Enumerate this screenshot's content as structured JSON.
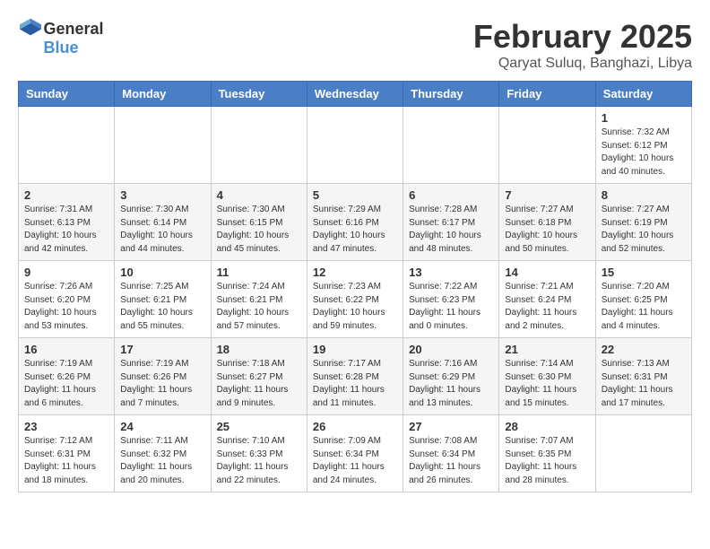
{
  "logo": {
    "general": "General",
    "blue": "Blue"
  },
  "title": {
    "month": "February 2025",
    "location": "Qaryat Suluq, Banghazi, Libya"
  },
  "headers": [
    "Sunday",
    "Monday",
    "Tuesday",
    "Wednesday",
    "Thursday",
    "Friday",
    "Saturday"
  ],
  "weeks": [
    [
      {
        "day": "",
        "info": ""
      },
      {
        "day": "",
        "info": ""
      },
      {
        "day": "",
        "info": ""
      },
      {
        "day": "",
        "info": ""
      },
      {
        "day": "",
        "info": ""
      },
      {
        "day": "",
        "info": ""
      },
      {
        "day": "1",
        "info": "Sunrise: 7:32 AM\nSunset: 6:12 PM\nDaylight: 10 hours\nand 40 minutes."
      }
    ],
    [
      {
        "day": "2",
        "info": "Sunrise: 7:31 AM\nSunset: 6:13 PM\nDaylight: 10 hours\nand 42 minutes."
      },
      {
        "day": "3",
        "info": "Sunrise: 7:30 AM\nSunset: 6:14 PM\nDaylight: 10 hours\nand 44 minutes."
      },
      {
        "day": "4",
        "info": "Sunrise: 7:30 AM\nSunset: 6:15 PM\nDaylight: 10 hours\nand 45 minutes."
      },
      {
        "day": "5",
        "info": "Sunrise: 7:29 AM\nSunset: 6:16 PM\nDaylight: 10 hours\nand 47 minutes."
      },
      {
        "day": "6",
        "info": "Sunrise: 7:28 AM\nSunset: 6:17 PM\nDaylight: 10 hours\nand 48 minutes."
      },
      {
        "day": "7",
        "info": "Sunrise: 7:27 AM\nSunset: 6:18 PM\nDaylight: 10 hours\nand 50 minutes."
      },
      {
        "day": "8",
        "info": "Sunrise: 7:27 AM\nSunset: 6:19 PM\nDaylight: 10 hours\nand 52 minutes."
      }
    ],
    [
      {
        "day": "9",
        "info": "Sunrise: 7:26 AM\nSunset: 6:20 PM\nDaylight: 10 hours\nand 53 minutes."
      },
      {
        "day": "10",
        "info": "Sunrise: 7:25 AM\nSunset: 6:21 PM\nDaylight: 10 hours\nand 55 minutes."
      },
      {
        "day": "11",
        "info": "Sunrise: 7:24 AM\nSunset: 6:21 PM\nDaylight: 10 hours\nand 57 minutes."
      },
      {
        "day": "12",
        "info": "Sunrise: 7:23 AM\nSunset: 6:22 PM\nDaylight: 10 hours\nand 59 minutes."
      },
      {
        "day": "13",
        "info": "Sunrise: 7:22 AM\nSunset: 6:23 PM\nDaylight: 11 hours\nand 0 minutes."
      },
      {
        "day": "14",
        "info": "Sunrise: 7:21 AM\nSunset: 6:24 PM\nDaylight: 11 hours\nand 2 minutes."
      },
      {
        "day": "15",
        "info": "Sunrise: 7:20 AM\nSunset: 6:25 PM\nDaylight: 11 hours\nand 4 minutes."
      }
    ],
    [
      {
        "day": "16",
        "info": "Sunrise: 7:19 AM\nSunset: 6:26 PM\nDaylight: 11 hours\nand 6 minutes."
      },
      {
        "day": "17",
        "info": "Sunrise: 7:19 AM\nSunset: 6:26 PM\nDaylight: 11 hours\nand 7 minutes."
      },
      {
        "day": "18",
        "info": "Sunrise: 7:18 AM\nSunset: 6:27 PM\nDaylight: 11 hours\nand 9 minutes."
      },
      {
        "day": "19",
        "info": "Sunrise: 7:17 AM\nSunset: 6:28 PM\nDaylight: 11 hours\nand 11 minutes."
      },
      {
        "day": "20",
        "info": "Sunrise: 7:16 AM\nSunset: 6:29 PM\nDaylight: 11 hours\nand 13 minutes."
      },
      {
        "day": "21",
        "info": "Sunrise: 7:14 AM\nSunset: 6:30 PM\nDaylight: 11 hours\nand 15 minutes."
      },
      {
        "day": "22",
        "info": "Sunrise: 7:13 AM\nSunset: 6:31 PM\nDaylight: 11 hours\nand 17 minutes."
      }
    ],
    [
      {
        "day": "23",
        "info": "Sunrise: 7:12 AM\nSunset: 6:31 PM\nDaylight: 11 hours\nand 18 minutes."
      },
      {
        "day": "24",
        "info": "Sunrise: 7:11 AM\nSunset: 6:32 PM\nDaylight: 11 hours\nand 20 minutes."
      },
      {
        "day": "25",
        "info": "Sunrise: 7:10 AM\nSunset: 6:33 PM\nDaylight: 11 hours\nand 22 minutes."
      },
      {
        "day": "26",
        "info": "Sunrise: 7:09 AM\nSunset: 6:34 PM\nDaylight: 11 hours\nand 24 minutes."
      },
      {
        "day": "27",
        "info": "Sunrise: 7:08 AM\nSunset: 6:34 PM\nDaylight: 11 hours\nand 26 minutes."
      },
      {
        "day": "28",
        "info": "Sunrise: 7:07 AM\nSunset: 6:35 PM\nDaylight: 11 hours\nand 28 minutes."
      },
      {
        "day": "",
        "info": ""
      }
    ]
  ]
}
